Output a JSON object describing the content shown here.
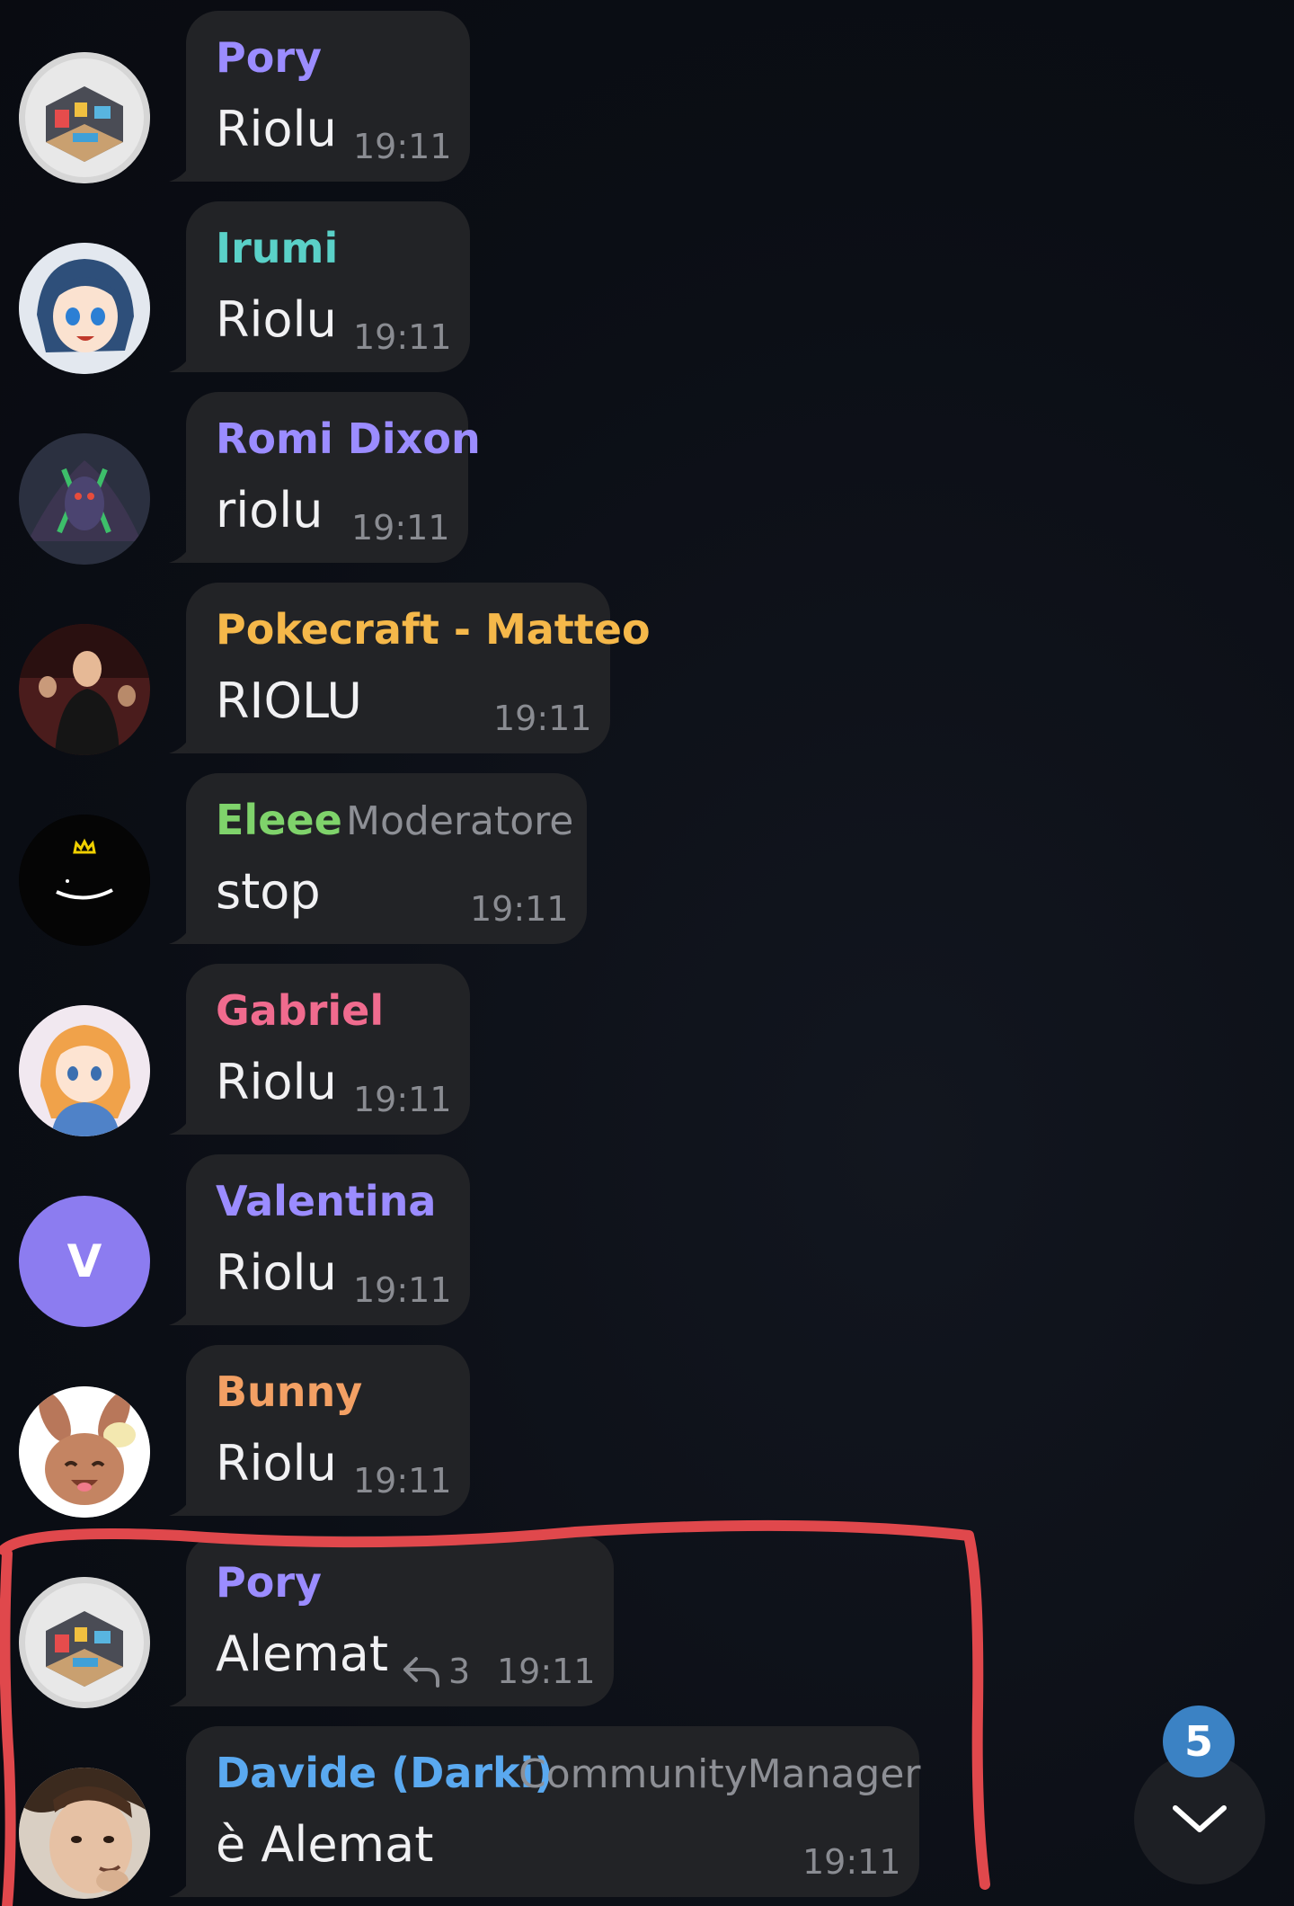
{
  "messages": [
    {
      "sender": "Pory",
      "sender_color": "#9b8cff",
      "role": "",
      "text": "Riolu",
      "time": "19:11",
      "avatar": "pory-room-avatar"
    },
    {
      "sender": "Irumi",
      "sender_color": "#5ad1c8",
      "role": "",
      "text": "Riolu",
      "time": "19:11",
      "avatar": "anime-girl-blue-hair-avatar"
    },
    {
      "sender": "Romi Dixon",
      "sender_color": "#9b8cff",
      "role": "",
      "text": "riolu",
      "time": "19:11",
      "avatar": "dark-creature-avatar"
    },
    {
      "sender": "Pokecraft - Matteo",
      "sender_color": "#f5b84a",
      "role": "",
      "text": "RIOLU",
      "time": "19:11",
      "avatar": "man-in-suit-avatar"
    },
    {
      "sender": "Eleee",
      "sender_color": "#7fd36b",
      "role": "Moderatore",
      "text": "stop",
      "time": "19:11",
      "avatar": "smile-crown-avatar"
    },
    {
      "sender": "Gabriel",
      "sender_color": "#f06b8e",
      "role": "",
      "text": "Riolu",
      "time": "19:11",
      "avatar": "anime-girl-orange-hair-avatar"
    },
    {
      "sender": "Valentina",
      "sender_color": "#9b8cff",
      "role": "",
      "text": "Riolu",
      "time": "19:11",
      "avatar": "letter-avatar",
      "initial": "V",
      "avatar_color": "#8c7cf0"
    },
    {
      "sender": "Bunny",
      "sender_color": "#f3a064",
      "role": "",
      "text": "Riolu",
      "time": "19:11",
      "avatar": "bunny-avatar"
    },
    {
      "sender": "Pory",
      "sender_color": "#9b8cff",
      "role": "",
      "text": "Alemat",
      "time": "19:11",
      "avatar": "pory-room-avatar",
      "replies": "3"
    },
    {
      "sender": "Davide (Darki)",
      "sender_color": "#5aa9f0",
      "role": "CommunityManager",
      "text": "è Alemat",
      "time": "19:11",
      "avatar": "man-photo-avatar"
    }
  ],
  "scroll": {
    "unread_count": "5"
  },
  "colors": {
    "bubble": "#222326",
    "highlight_stroke": "#e0484c"
  }
}
